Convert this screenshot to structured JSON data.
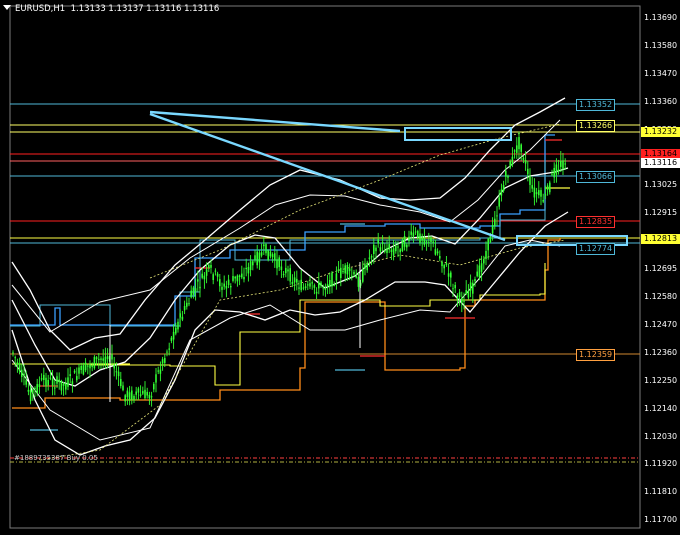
{
  "header": {
    "symbol": "EURUSD,H1",
    "ohlc": "1.13133 1.13137 1.13116 1.13116"
  },
  "price_axis": {
    "labels": [
      "1.13690",
      "1.13580",
      "1.13470",
      "1.13360",
      "1.13250",
      "1.13135",
      "1.13025",
      "1.12915",
      "1.12805",
      "1.12695",
      "1.12580",
      "1.12470",
      "1.12360",
      "1.12250",
      "1.12140",
      "1.12030",
      "1.11920",
      "1.11810",
      "1.11700"
    ]
  },
  "level_tags": [
    {
      "text": "1.13352",
      "color": "#4fb8d8"
    },
    {
      "text": "1.13266",
      "color": "#ffff66"
    },
    {
      "text": "1.13066",
      "color": "#4fb8d8"
    },
    {
      "text": "1.12835",
      "color": "#ff3030"
    },
    {
      "text": "1.12774",
      "color": "#4fb8d8"
    },
    {
      "text": "1.12359",
      "color": "#ffa040"
    }
  ],
  "current_price_tags": [
    {
      "text": "1.13232",
      "bg": "#ffff33",
      "fg": "#000000"
    },
    {
      "text": "1.13164",
      "bg": "#ff2020",
      "fg": "#000000"
    },
    {
      "text": "1.13116",
      "bg": "#ffffff",
      "fg": "#000000"
    },
    {
      "text": "1.12813",
      "bg": "#ffff33",
      "fg": "#000000"
    }
  ],
  "footer_text": "#1889735387 Buy 0.05",
  "colors": {
    "candles": "#33ff33",
    "bands": "#ffffff",
    "steps_blue": "#3aa0ff",
    "steps_orange": "#ff8c1a",
    "yellow": "#ffff44",
    "red": "#ff2020",
    "arrow": "#7ad8ff"
  }
}
